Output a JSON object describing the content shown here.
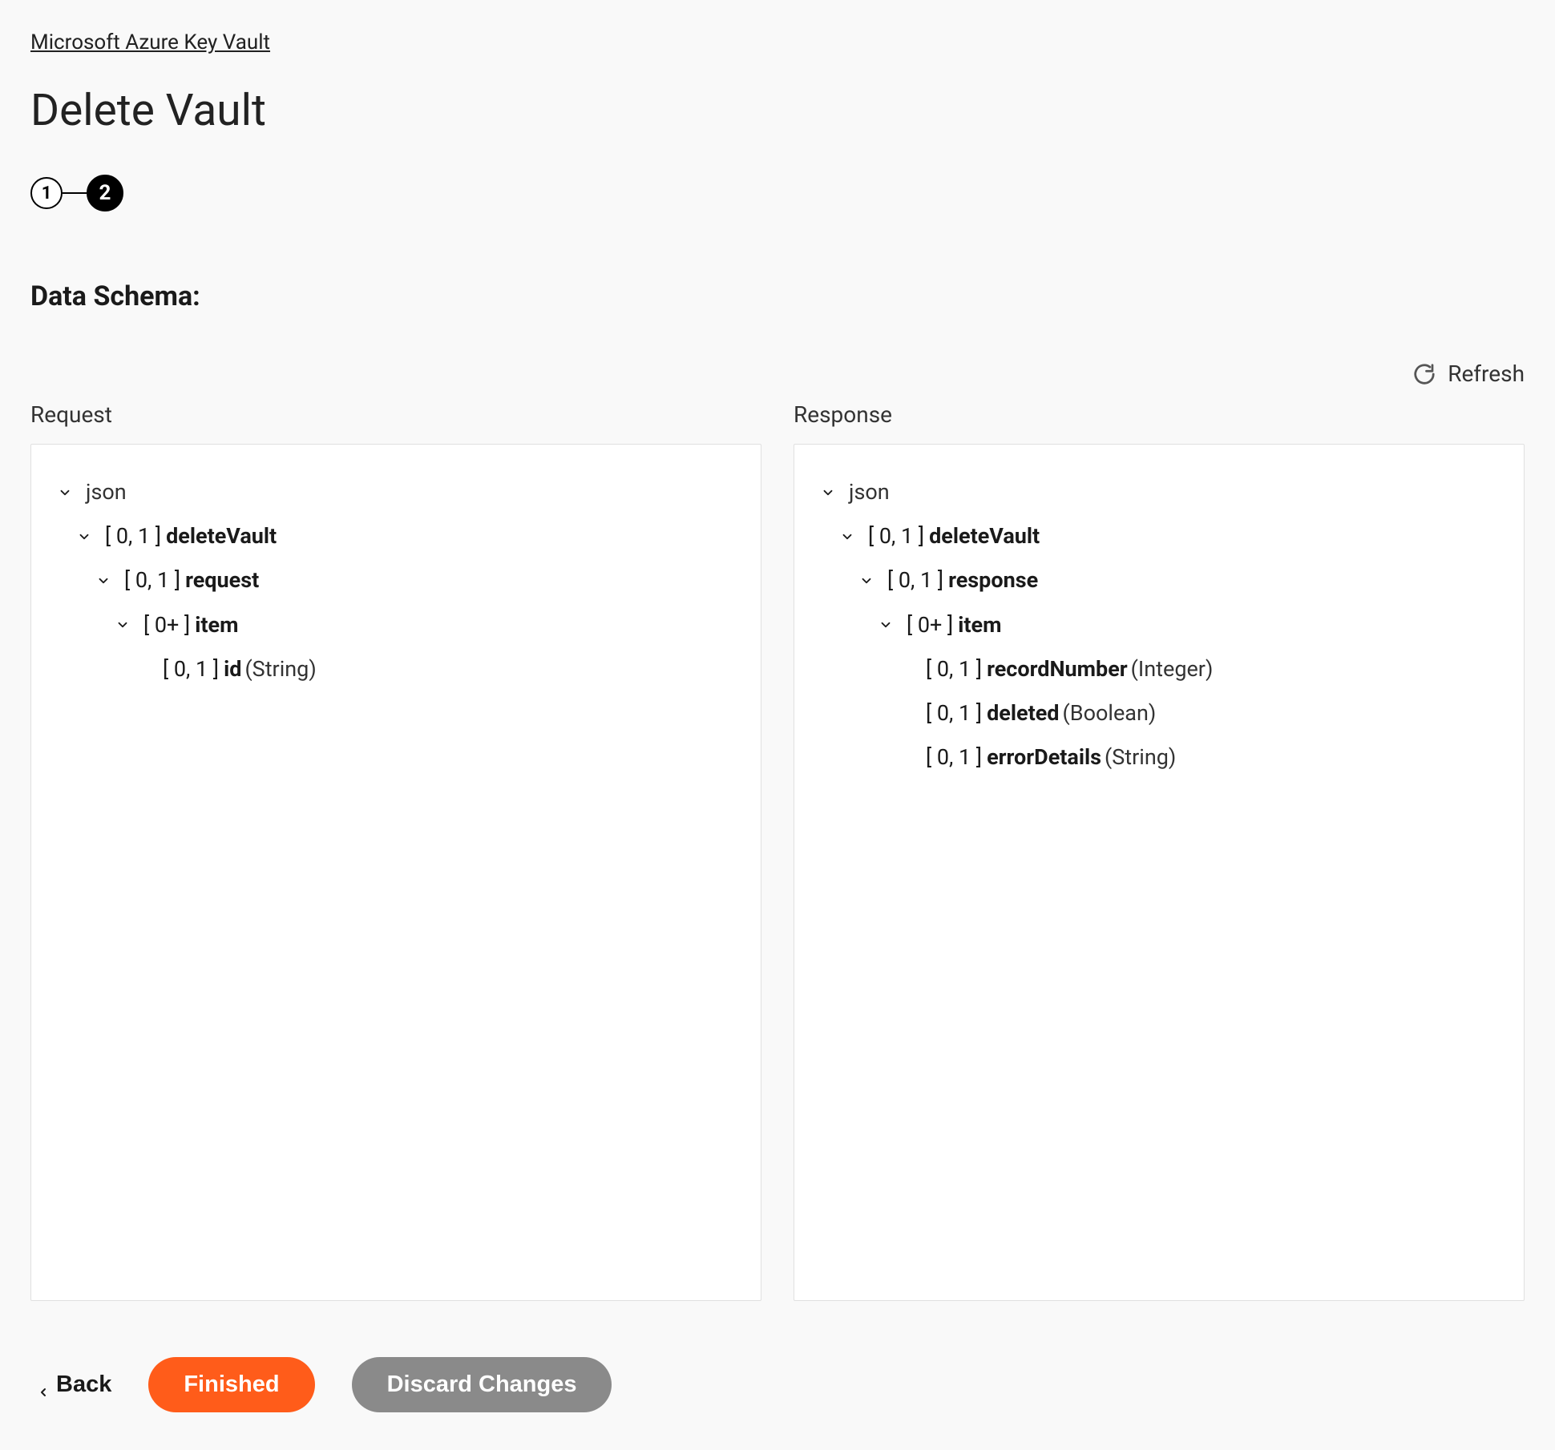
{
  "breadcrumb": "Microsoft Azure Key Vault",
  "pageTitle": "Delete Vault",
  "stepper": {
    "step1": "1",
    "step2": "2"
  },
  "sectionTitle": "Data Schema:",
  "refreshLabel": "Refresh",
  "panels": {
    "request": {
      "label": "Request",
      "tree": [
        {
          "indent": 0,
          "chevron": true,
          "plain": "json"
        },
        {
          "indent": 1,
          "chevron": true,
          "cardinality": "[ 0, 1 ]",
          "name": "deleteVault"
        },
        {
          "indent": 2,
          "chevron": true,
          "cardinality": "[ 0, 1 ]",
          "name": "request"
        },
        {
          "indent": 3,
          "chevron": true,
          "cardinality": "[ 0+ ]",
          "name": "item"
        },
        {
          "indent": 4,
          "chevron": false,
          "cardinality": "[ 0, 1 ]",
          "name": "id",
          "type": "(String)"
        }
      ]
    },
    "response": {
      "label": "Response",
      "tree": [
        {
          "indent": 0,
          "chevron": true,
          "plain": "json"
        },
        {
          "indent": 1,
          "chevron": true,
          "cardinality": "[ 0, 1 ]",
          "name": "deleteVault"
        },
        {
          "indent": 2,
          "chevron": true,
          "cardinality": "[ 0, 1 ]",
          "name": "response"
        },
        {
          "indent": 3,
          "chevron": true,
          "cardinality": "[ 0+ ]",
          "name": "item"
        },
        {
          "indent": 4,
          "chevron": false,
          "cardinality": "[ 0, 1 ]",
          "name": "recordNumber",
          "type": "(Integer)"
        },
        {
          "indent": 4,
          "chevron": false,
          "cardinality": "[ 0, 1 ]",
          "name": "deleted",
          "type": "(Boolean)"
        },
        {
          "indent": 4,
          "chevron": false,
          "cardinality": "[ 0, 1 ]",
          "name": "errorDetails",
          "type": "(String)"
        }
      ]
    }
  },
  "footer": {
    "back": "Back",
    "finished": "Finished",
    "discard": "Discard Changes"
  }
}
